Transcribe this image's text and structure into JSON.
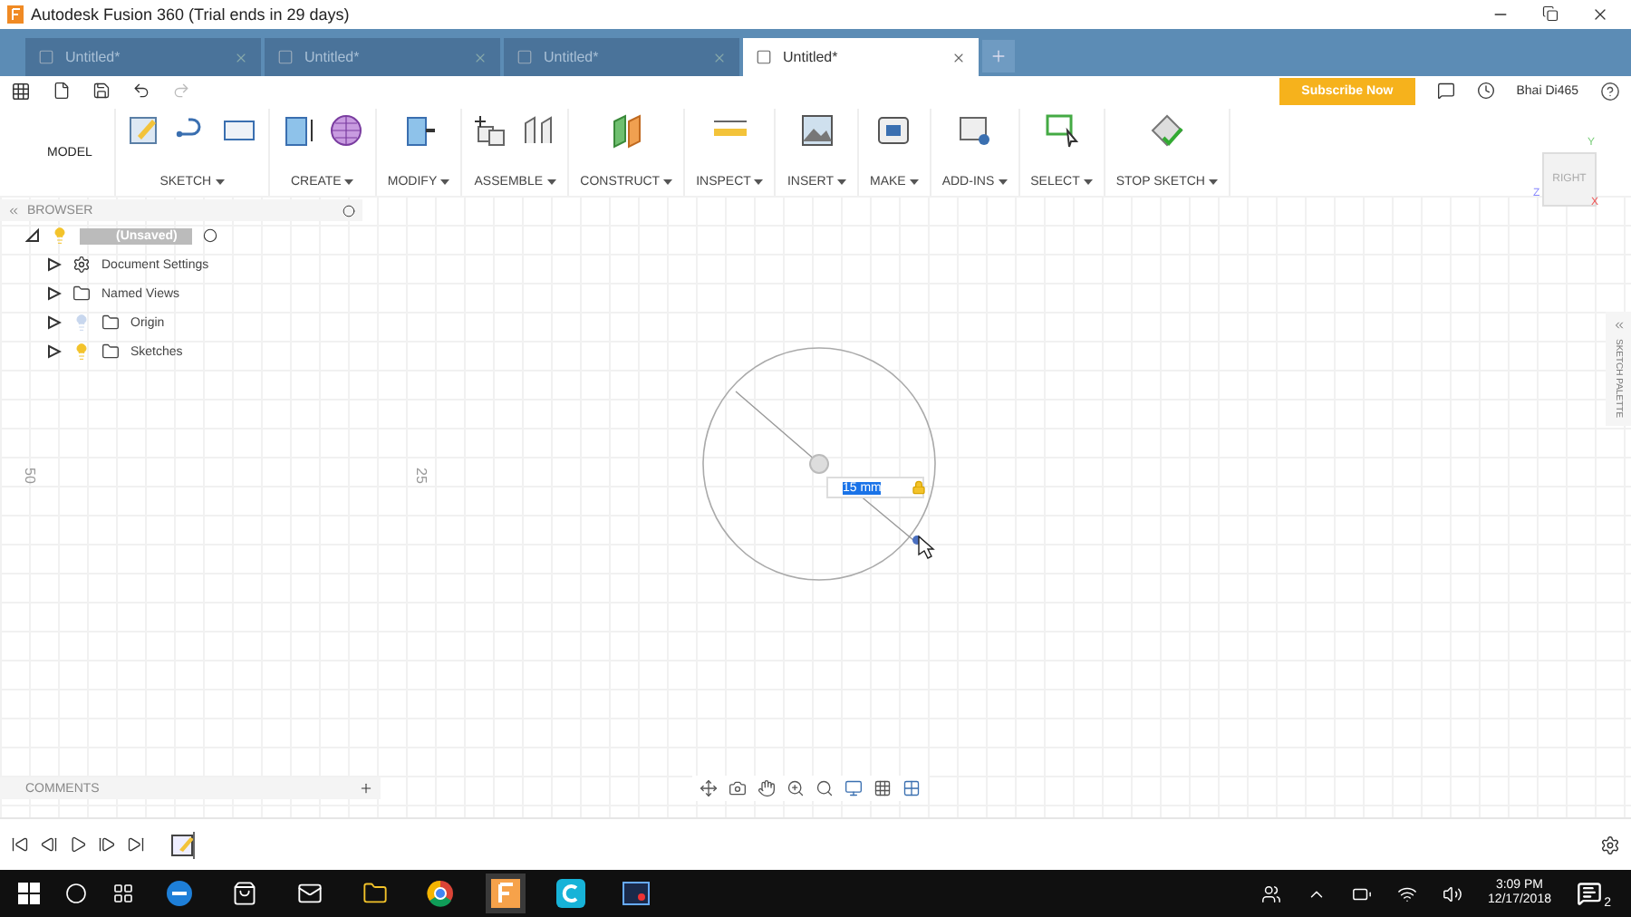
{
  "window": {
    "title": "Autodesk Fusion 360 (Trial ends in 29 days)"
  },
  "tabs": [
    {
      "label": "Untitled*",
      "selected": false
    },
    {
      "label": "Untitled*",
      "selected": false
    },
    {
      "label": "Untitled*",
      "selected": false
    },
    {
      "label": "Untitled*",
      "selected": true
    }
  ],
  "toolbar": {
    "subscribe": "Subscribe Now",
    "user": "Bhai Di465"
  },
  "ribbon": {
    "mode": "MODEL",
    "groups": [
      {
        "label": "SKETCH"
      },
      {
        "label": "CREATE"
      },
      {
        "label": "MODIFY"
      },
      {
        "label": "ASSEMBLE"
      },
      {
        "label": "CONSTRUCT"
      },
      {
        "label": "INSPECT"
      },
      {
        "label": "INSERT"
      },
      {
        "label": "MAKE"
      },
      {
        "label": "ADD-INS"
      },
      {
        "label": "SELECT"
      },
      {
        "label": "STOP SKETCH"
      }
    ]
  },
  "browser": {
    "title": "BROWSER",
    "root": {
      "label": "(Unsaved)",
      "expanded": true,
      "children": [
        {
          "label": "Document Settings",
          "kind": "gear",
          "expanded": false
        },
        {
          "label": "Named Views",
          "kind": "folder",
          "expanded": false
        },
        {
          "label": "Origin",
          "kind": "bulb-folder",
          "lit": false,
          "expanded": false
        },
        {
          "label": "Sketches",
          "kind": "bulb-folder",
          "lit": true,
          "expanded": false
        }
      ]
    }
  },
  "canvas": {
    "axis_labels": [
      "50",
      "25"
    ],
    "dimension": "15 mm",
    "viewcube": "RIGHT",
    "axes": [
      "Y",
      "Z",
      "X"
    ],
    "palette": "SKETCH PALETTE"
  },
  "comments": {
    "title": "COMMENTS"
  },
  "taskbar": {
    "time": "3:09 PM",
    "date": "12/17/2018",
    "notifications": "2"
  }
}
